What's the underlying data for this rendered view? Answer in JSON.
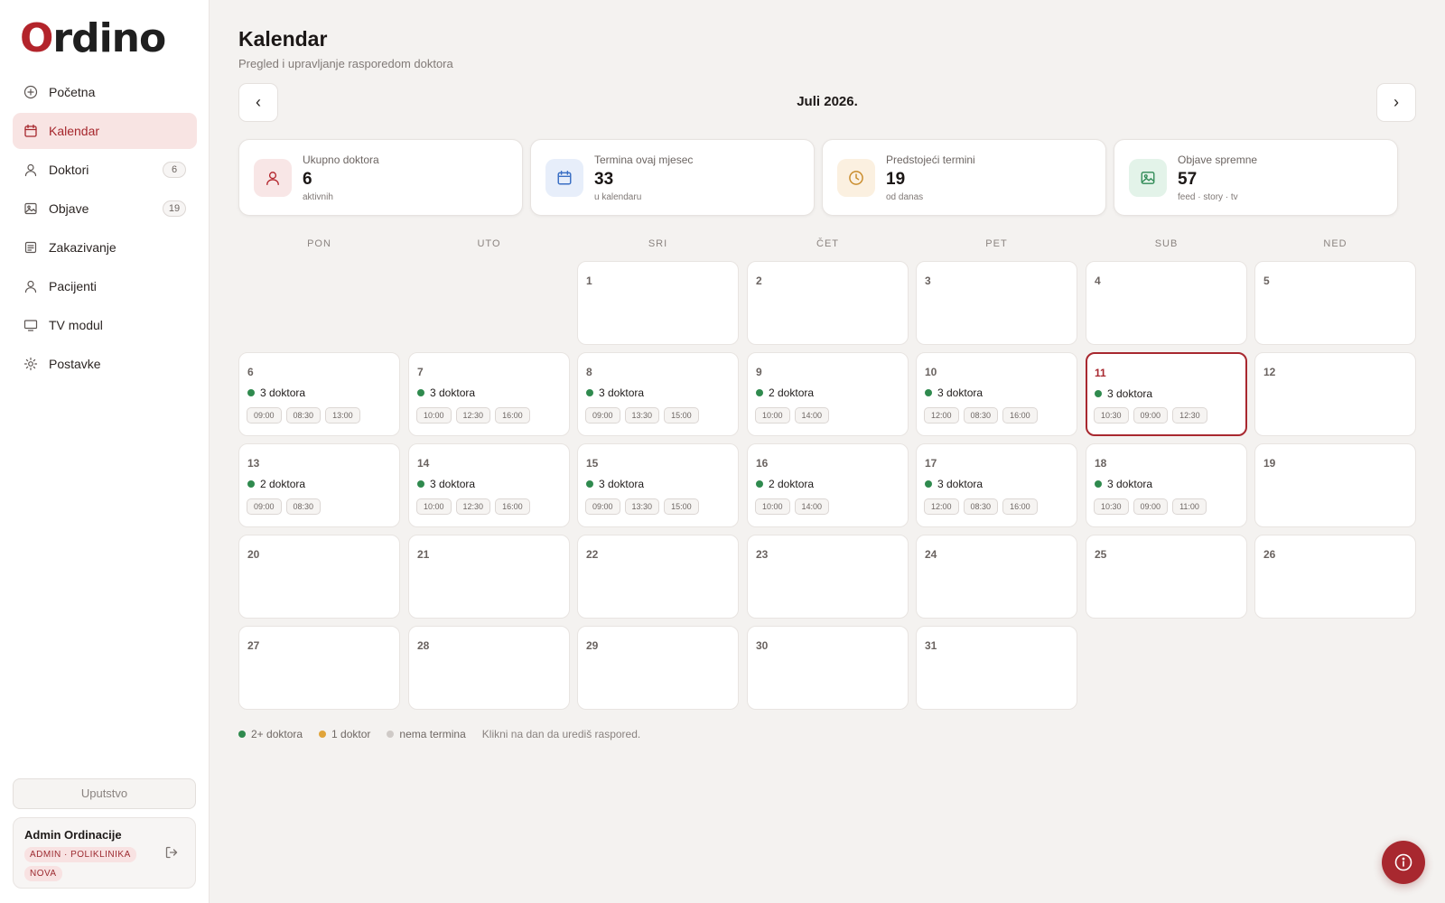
{
  "brand": {
    "logo_first": "O",
    "logo_rest": "rdino",
    "accent": "#a8282f"
  },
  "sidebar": {
    "items": [
      {
        "label": "Početna",
        "icon": "plus-circle-icon",
        "active": false,
        "badge": null
      },
      {
        "label": "Kalendar",
        "icon": "calendar-icon",
        "active": true,
        "badge": null
      },
      {
        "label": "Doktori",
        "icon": "user-icon",
        "active": false,
        "badge": "6"
      },
      {
        "label": "Objave",
        "icon": "image-icon",
        "active": false,
        "badge": "19"
      },
      {
        "label": "Zakazivanje",
        "icon": "clipboard-icon",
        "active": false,
        "badge": null
      },
      {
        "label": "Pacijenti",
        "icon": "user-icon",
        "active": false,
        "badge": null
      },
      {
        "label": "TV modul",
        "icon": "monitor-icon",
        "active": false,
        "badge": null
      },
      {
        "label": "Postavke",
        "icon": "sun-gear-icon",
        "active": false,
        "badge": null
      }
    ],
    "guide_label": "Uputstvo",
    "user": {
      "name": "Admin Ordinacije",
      "role": "ADMIN · POLIKLINIKA NOVA"
    }
  },
  "header": {
    "title": "Kalendar",
    "subtitle": "Pregled i upravljanje rasporedom doktora"
  },
  "month_nav": {
    "prev": "‹",
    "next": "›",
    "label": "Juli 2026."
  },
  "stats": [
    {
      "label": "Ukupno doktora",
      "value": "6",
      "sub": "aktivnih",
      "icon": "user-icon",
      "color": "#b3242b",
      "bg": "#f8e6e6"
    },
    {
      "label": "Termina ovaj mjesec",
      "value": "33",
      "sub": "u kalendaru",
      "icon": "calendar-icon",
      "color": "#3a6fc4",
      "bg": "#e7eefa"
    },
    {
      "label": "Predstojeći termini",
      "value": "19",
      "sub": "od danas",
      "icon": "clock-icon",
      "color": "#c98b2a",
      "bg": "#fbf0e0"
    },
    {
      "label": "Objave spremne",
      "value": "57",
      "sub": "feed · story · tv",
      "icon": "image-icon",
      "color": "#2f8a55",
      "bg": "#e3f3e9"
    }
  ],
  "weekdays": [
    "PON",
    "UTO",
    "SRI",
    "ČET",
    "PET",
    "SUB",
    "NED"
  ],
  "calendar": {
    "first_weekday_index": 2,
    "today": 11,
    "days": [
      {
        "day": "1"
      },
      {
        "day": "2"
      },
      {
        "day": "3"
      },
      {
        "day": "4"
      },
      {
        "day": "5"
      },
      {
        "day": "6",
        "doctors": "3 doktora",
        "times": [
          "09:00",
          "08:30",
          "13:00"
        ]
      },
      {
        "day": "7",
        "doctors": "3 doktora",
        "times": [
          "10:00",
          "12:30",
          "16:00"
        ]
      },
      {
        "day": "8",
        "doctors": "3 doktora",
        "times": [
          "09:00",
          "13:30",
          "15:00"
        ]
      },
      {
        "day": "9",
        "doctors": "2 doktora",
        "times": [
          "10:00",
          "14:00"
        ]
      },
      {
        "day": "10",
        "doctors": "3 doktora",
        "times": [
          "12:00",
          "08:30",
          "16:00"
        ]
      },
      {
        "day": "11",
        "doctors": "3 doktora",
        "times": [
          "10:30",
          "09:00",
          "12:30"
        ]
      },
      {
        "day": "12"
      },
      {
        "day": "13",
        "doctors": "2 doktora",
        "times": [
          "09:00",
          "08:30"
        ]
      },
      {
        "day": "14",
        "doctors": "3 doktora",
        "times": [
          "10:00",
          "12:30",
          "16:00"
        ]
      },
      {
        "day": "15",
        "doctors": "3 doktora",
        "times": [
          "09:00",
          "13:30",
          "15:00"
        ]
      },
      {
        "day": "16",
        "doctors": "2 doktora",
        "times": [
          "10:00",
          "14:00"
        ]
      },
      {
        "day": "17",
        "doctors": "3 doktora",
        "times": [
          "12:00",
          "08:30",
          "16:00"
        ]
      },
      {
        "day": "18",
        "doctors": "3 doktora",
        "times": [
          "10:30",
          "09:00",
          "11:00"
        ]
      },
      {
        "day": "19"
      },
      {
        "day": "20"
      },
      {
        "day": "21"
      },
      {
        "day": "22"
      },
      {
        "day": "23"
      },
      {
        "day": "24"
      },
      {
        "day": "25"
      },
      {
        "day": "26"
      },
      {
        "day": "27"
      },
      {
        "day": "28"
      },
      {
        "day": "29"
      },
      {
        "day": "30"
      },
      {
        "day": "31"
      }
    ]
  },
  "legend": {
    "items": [
      {
        "label": "2+ doktora",
        "color": "#2f8a4e"
      },
      {
        "label": "1 doktor",
        "color": "#e0a43a"
      },
      {
        "label": "nema termina",
        "color": "#cfcac7"
      }
    ],
    "hint": "Klikni na dan da urediš raspored."
  },
  "fab": {
    "icon": "info-icon"
  }
}
